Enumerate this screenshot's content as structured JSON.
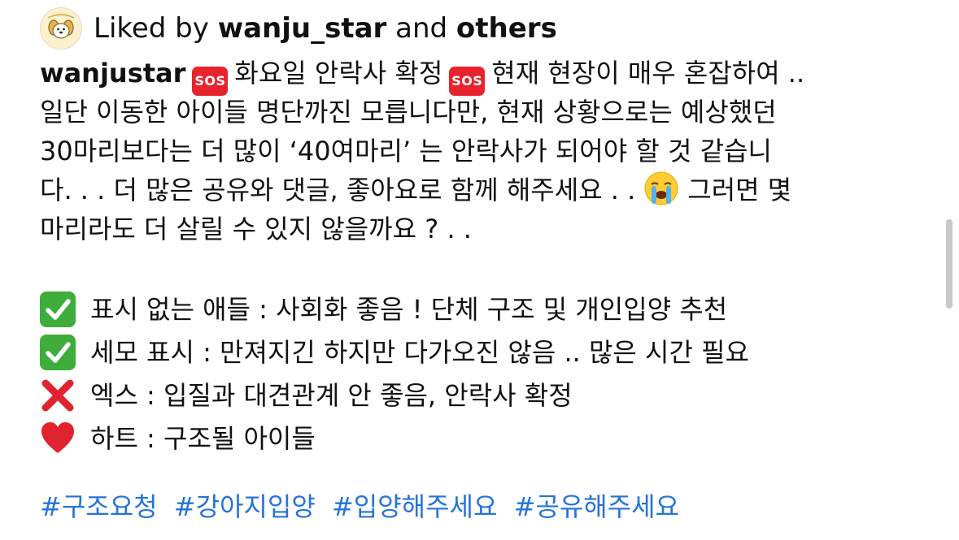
{
  "liked": {
    "prefix": "Liked by",
    "user": "wanju_star",
    "connector": "and",
    "others": "others"
  },
  "post": {
    "username": "wanjustar",
    "sos_label": "SOS",
    "line1_a": "화요일 안락사 확정",
    "line1_b": "현재 현장이 매우 혼잡하여 ..",
    "line2": "일단 이동한 아이들 명단까진 모릅니다만, 현재 상황으로는 예상했던",
    "line3": "30마리보다는 더 많이 ‘40여마리’ 는 안락사가 되어야 할 것 같습니",
    "line4_a": "다. . . 더 많은 공유와 댓글, 좋아요로 함께 해주세요 . .",
    "line4_b": "그러면 몇",
    "line5": "마리라도 더 살릴 수 있지 않을까요 ? . ."
  },
  "legend": [
    {
      "icon": "check-mark-icon",
      "text": "표시 없는 애들 : 사회화 좋음 ! 단체 구조 및 개인입양 추천"
    },
    {
      "icon": "check-mark-icon",
      "text": "세모 표시 : 만져지긴 하지만 다가오진 않음 .. 많은 시간 필요"
    },
    {
      "icon": "cross-mark-icon",
      "text": "엑스 : 입질과 대견관계 안 좋음, 안락사 확정"
    },
    {
      "icon": "red-heart-icon",
      "text": "하트 : 구조될 아이들"
    }
  ],
  "hashtags": [
    "#구조요청",
    "#강아지입양",
    "#입양해주세요",
    "#공유해주세요"
  ],
  "colors": {
    "hashtag": "#2474d9",
    "sos_background": "#e8232d",
    "check_green": "#3ead3c",
    "cross_red": "#e0242f",
    "heart_red": "#e0242f"
  }
}
